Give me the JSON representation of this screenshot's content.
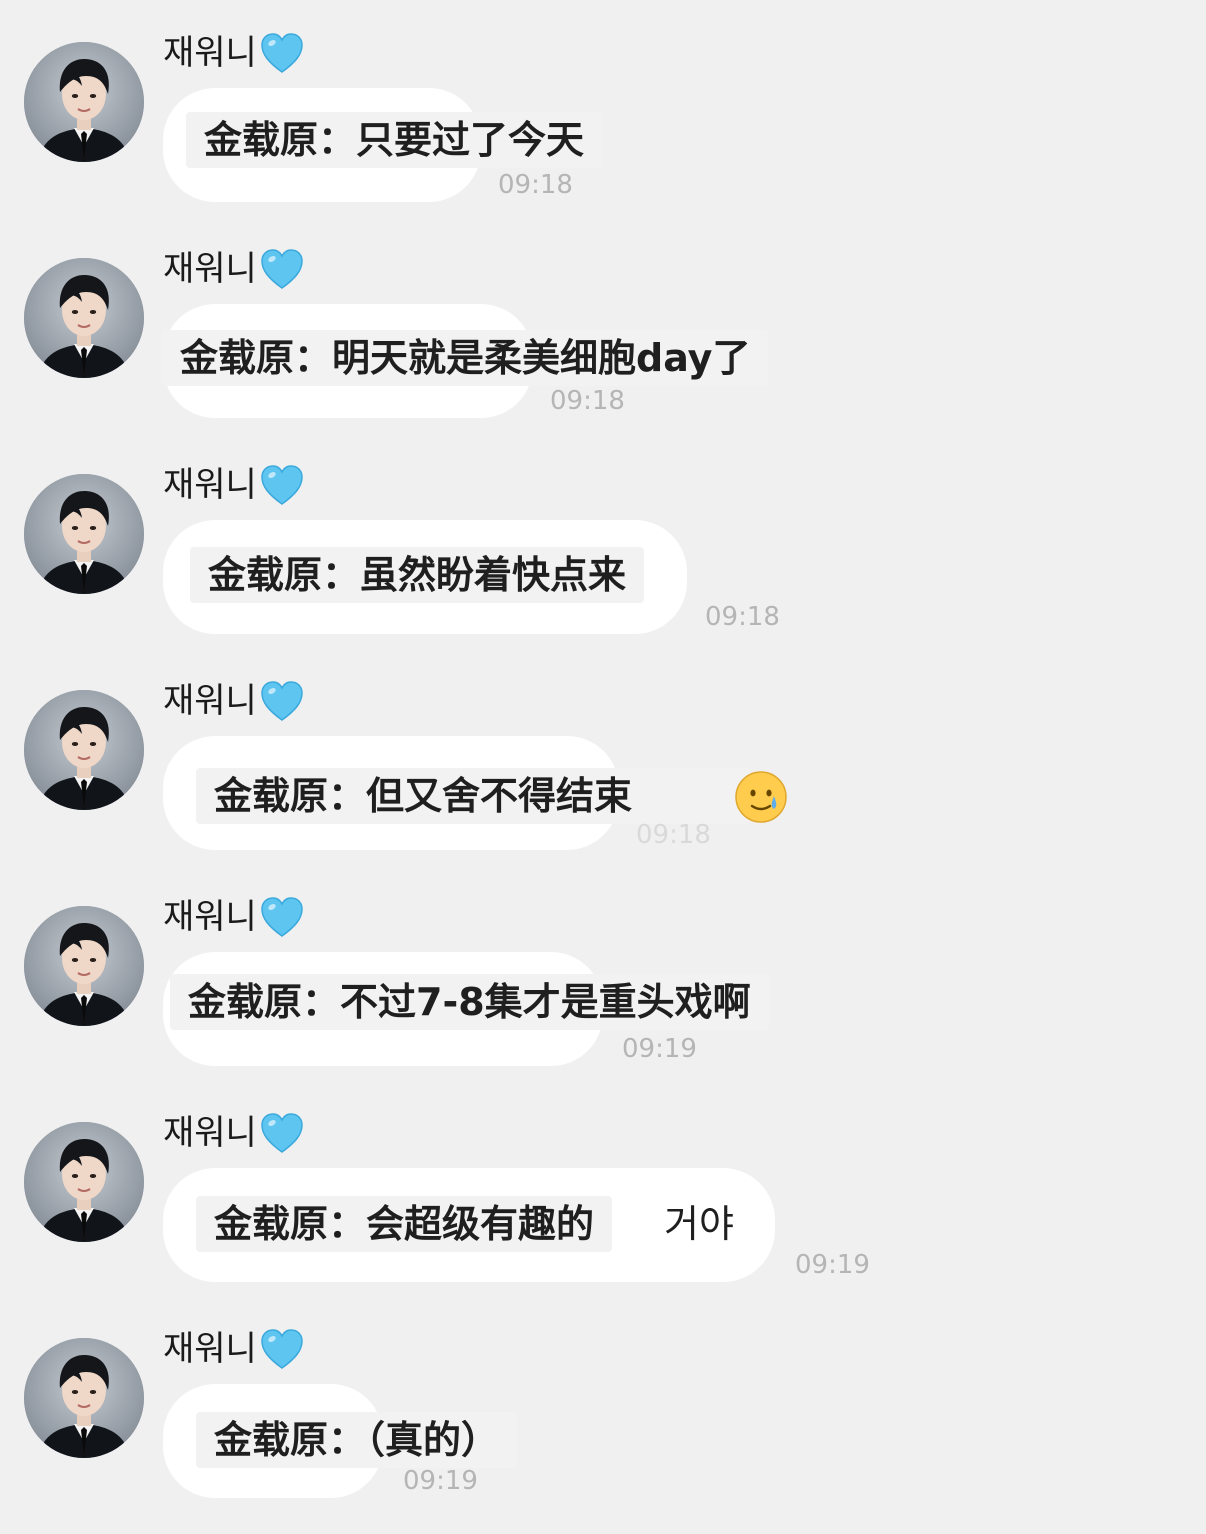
{
  "sender": {
    "name": "재워니"
  },
  "messages": [
    {
      "caption": "金载原：只要过了今天",
      "tail": "",
      "time": "09:18"
    },
    {
      "caption": "金载原：明天就是柔美细胞day了",
      "tail": "",
      "time": "09:18"
    },
    {
      "caption": "金载原：虽然盼着快点来",
      "tail": "",
      "time": "09:18"
    },
    {
      "caption": "金载原：但又舍不得结束",
      "tail": "",
      "time": "09:18",
      "emoji": "crying-smile-emoji"
    },
    {
      "caption": "金载原：不过7-8集才是重头戏啊",
      "tail": "",
      "time": "09:19"
    },
    {
      "caption": "金载原：会超级有趣的",
      "tail": "거야",
      "time": "09:19"
    },
    {
      "caption": "金载原：（真的）",
      "tail": "",
      "time": "09:19"
    }
  ],
  "colors": {
    "background": "#f0f0f0",
    "bubble": "#ffffff",
    "caption_bg": "#f2f2f2",
    "heart": "#5ec4f0",
    "time": "#b5b5b5"
  },
  "icons": {
    "heart": "light-blue-heart-emoji"
  }
}
